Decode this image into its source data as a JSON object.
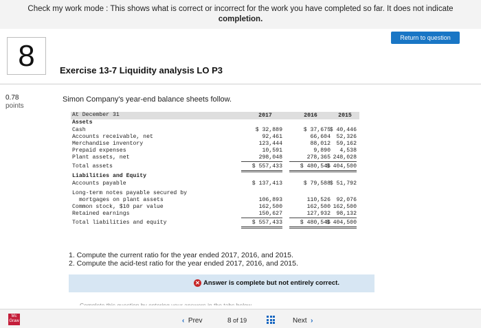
{
  "banner": {
    "line1": "Check my work mode : This shows what is correct or incorrect for the work you have completed so far. It does not indicate",
    "line2": "completion."
  },
  "return_button": "Return to question",
  "question_number": "8",
  "exercise_title": "Exercise 13-7 Liquidity analysis LO P3",
  "points": {
    "value": "0.78",
    "label": "points"
  },
  "intro": "Simon Company's year-end balance sheets follow.",
  "balance_sheet": {
    "header_label": "At December 31",
    "years": [
      "2017",
      "2016",
      "2015"
    ],
    "assets_heading": "Assets",
    "rows": [
      {
        "label": "Cash",
        "v1": "$  32,889",
        "v2": "$  37,675",
        "v3": "$  40,446"
      },
      {
        "label": "Accounts receivable, net",
        "v1": "92,461",
        "v2": "66,604",
        "v3": "52,326"
      },
      {
        "label": "Merchandise inventory",
        "v1": "123,444",
        "v2": "88,012",
        "v3": "59,162"
      },
      {
        "label": "Prepaid expenses",
        "v1": "10,591",
        "v2": "9,890",
        "v3": "4,538"
      },
      {
        "label": "Plant assets, net",
        "v1": "298,048",
        "v2": "278,365",
        "v3": "248,028"
      }
    ],
    "total_assets": {
      "label": "Total assets",
      "v1": "$ 557,433",
      "v2": "$ 480,546",
      "v3": "$ 404,500"
    },
    "liab_heading": "Liabilities and Equity",
    "accounts_payable": {
      "label": "Accounts payable",
      "v1": "$ 137,413",
      "v2": "$  79,588",
      "v3": "$  51,792"
    },
    "lt_notes_label1": "Long-term notes payable secured by",
    "lt_notes_label2": "mortgages on plant assets",
    "lt_notes": {
      "v1": "106,893",
      "v2": "110,526",
      "v3": "92,076"
    },
    "common_stock": {
      "label": "Common stock, $10 par value",
      "v1": "162,500",
      "v2": "162,500",
      "v3": "162,500"
    },
    "retained_earnings": {
      "label": "Retained earnings",
      "v1": "150,627",
      "v2": "127,932",
      "v3": "98,132"
    },
    "total_liab": {
      "label": "Total liabilities and equity",
      "v1": "$ 557,433",
      "v2": "$ 480,546",
      "v3": "$ 404,500"
    }
  },
  "questions": [
    "1. Compute the current ratio for the year ended 2017, 2016, and 2015.",
    "2. Compute the acid-test ratio for the year ended 2017, 2016, and 2015."
  ],
  "answer_status": "Answer is complete but not entirely correct.",
  "cutoff_text": "Complete this question by entering your answers in the tabs below.",
  "footer": {
    "logo_text": "Mc Graw",
    "prev_label": "Prev",
    "page_current": "8",
    "page_of": "of",
    "page_total": "19",
    "next_label": "Next"
  },
  "colors": {
    "accent": "#1976c5",
    "answer_bar": "#d7e6f3",
    "error": "#c62828",
    "logo": "#c41e3a"
  },
  "icons": [
    "x-circle-icon",
    "chevron-left-icon",
    "chevron-right-icon",
    "grid-icon"
  ]
}
